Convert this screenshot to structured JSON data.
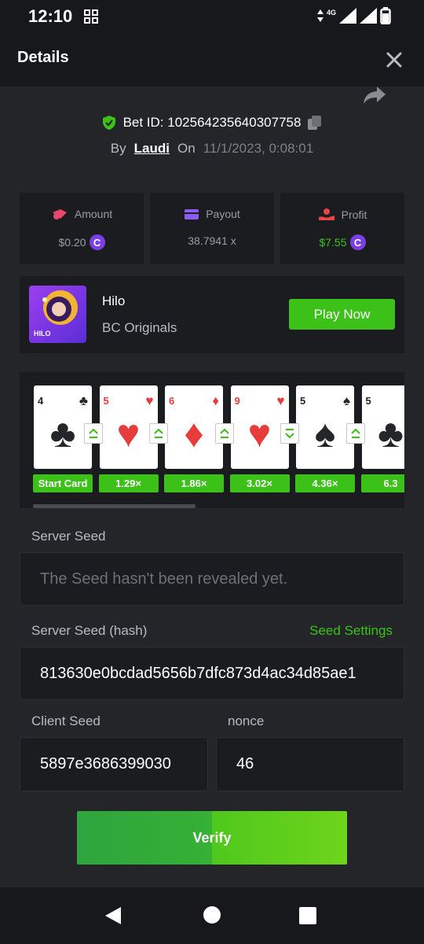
{
  "status": {
    "time": "12:10",
    "network": "4G"
  },
  "header": {
    "title": "Details"
  },
  "bet": {
    "id_label": "Bet ID: 102564235640307758",
    "by_label": "By",
    "user": "Laudi",
    "on_label": "On",
    "date": "11/1/2023, 0:08:01"
  },
  "stats": {
    "amount": {
      "label": "Amount",
      "value": "$0.20",
      "coin": "C"
    },
    "payout": {
      "label": "Payout",
      "value": "38.7941 x"
    },
    "profit": {
      "label": "Profit",
      "value": "$7.55",
      "coin": "C",
      "color": "#3bc117"
    }
  },
  "game": {
    "name": "Hilo",
    "provider": "BC Originals",
    "thumb_text": "HILO",
    "play_label": "Play Now"
  },
  "cards": [
    {
      "rank": "4",
      "suit": "♣",
      "color": "dark",
      "multiplier": "Start Card",
      "arrow": ""
    },
    {
      "rank": "5",
      "suit": "♥",
      "color": "red",
      "multiplier": "1.29×",
      "arrow": "up"
    },
    {
      "rank": "6",
      "suit": "♦",
      "color": "red",
      "multiplier": "1.86×",
      "arrow": "up"
    },
    {
      "rank": "9",
      "suit": "♥",
      "color": "red",
      "multiplier": "3.02×",
      "arrow": "up"
    },
    {
      "rank": "5",
      "suit": "♠",
      "color": "dark",
      "multiplier": "4.36×",
      "arrow": "down"
    },
    {
      "rank": "5",
      "suit": "♣",
      "color": "dark",
      "multiplier": "6.3",
      "arrow": "up"
    }
  ],
  "server_seed": {
    "label": "Server Seed",
    "placeholder": "The Seed hasn't been revealed yet."
  },
  "server_seed_hash": {
    "label": "Server Seed (hash)",
    "settings_label": "Seed Settings",
    "value": "813630e0bcdad5656b7dfc873d4ac34d85ae1"
  },
  "client_seed": {
    "label": "Client Seed",
    "value": "5897e3686399030"
  },
  "nonce": {
    "label": "nonce",
    "value": "46"
  },
  "verify_label": "Verify",
  "colors": {
    "accent": "#3bc117",
    "panel": "#1b1c20",
    "background": "#232529"
  }
}
